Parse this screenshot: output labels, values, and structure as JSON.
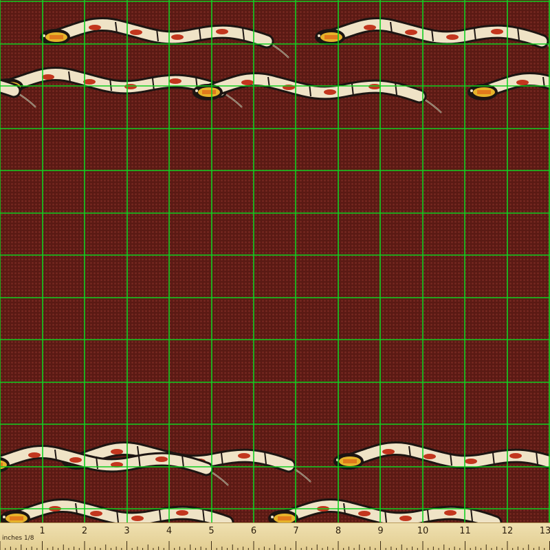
{
  "ruler": {
    "unit_label": "inches 1/8",
    "numbers": [
      "1",
      "2",
      "3",
      "4",
      "5",
      "6",
      "7",
      "8",
      "9",
      "10",
      "11",
      "12",
      "13"
    ]
  },
  "colors": {
    "background": "#5a1a14",
    "texture_dot": "#7a2a22",
    "grid_line": "#10d020",
    "snake_cream": "#efe3c6",
    "snake_outline": "#1c1512",
    "snake_red": "#c2361e",
    "snake_orange": "#e07a1c",
    "snake_yellow": "#e6b32a",
    "ruler_bg": "#ead9a8"
  },
  "icons": [
    "snake-motif"
  ]
}
